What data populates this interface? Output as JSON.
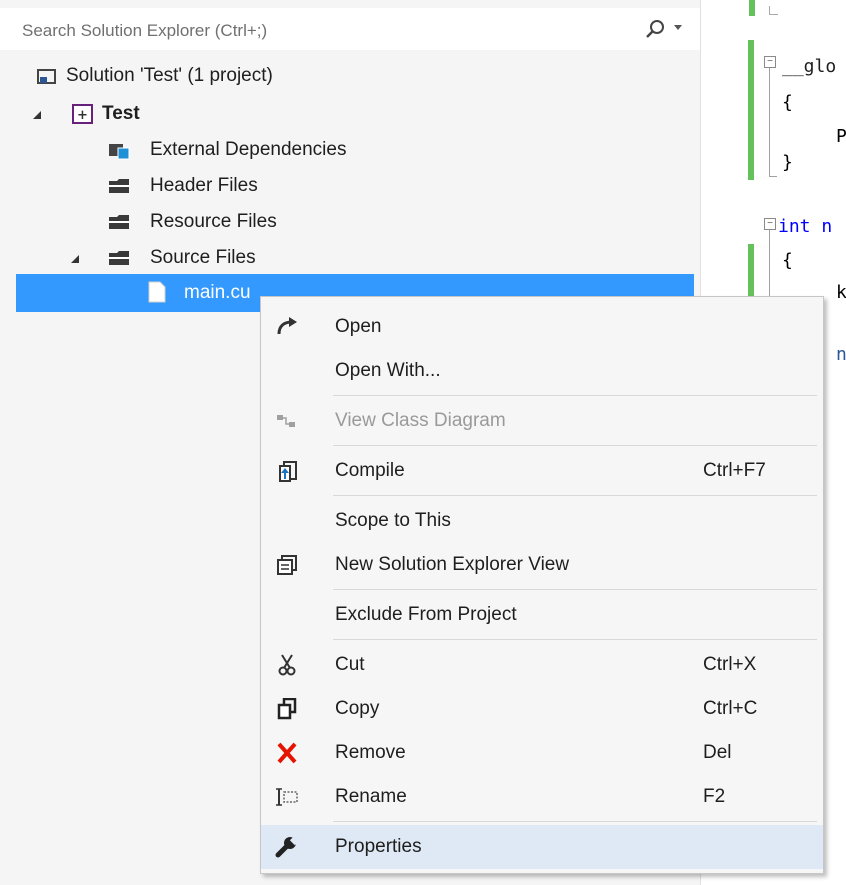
{
  "search": {
    "placeholder": "Search Solution Explorer (Ctrl+;)"
  },
  "tree": {
    "solution": "Solution 'Test' (1 project)",
    "project": "Test",
    "folders": [
      "External Dependencies",
      "Header Files",
      "Resource Files",
      "Source Files"
    ],
    "selected_file": "main.cu"
  },
  "code": [
    "__glo",
    "{",
    "P",
    "}",
    "int n",
    "{",
    "k",
    "n"
  ],
  "menu": {
    "items": [
      {
        "label": "Open",
        "shortcut": "",
        "icon": "open-arrow-icon",
        "disabled": false
      },
      {
        "label": "Open With...",
        "shortcut": "",
        "icon": "",
        "disabled": false
      },
      {
        "label": "View Class Diagram",
        "shortcut": "",
        "icon": "class-diagram-icon",
        "disabled": true
      },
      {
        "label": "Compile",
        "shortcut": "Ctrl+F7",
        "icon": "compile-icon",
        "disabled": false
      },
      {
        "label": "Scope to This",
        "shortcut": "",
        "icon": "",
        "disabled": false
      },
      {
        "label": "New Solution Explorer View",
        "shortcut": "",
        "icon": "new-view-icon",
        "disabled": false
      },
      {
        "label": "Exclude From Project",
        "shortcut": "",
        "icon": "",
        "disabled": false
      },
      {
        "label": "Cut",
        "shortcut": "Ctrl+X",
        "icon": "scissors-icon",
        "disabled": false
      },
      {
        "label": "Copy",
        "shortcut": "Ctrl+C",
        "icon": "copy-icon",
        "disabled": false
      },
      {
        "label": "Remove",
        "shortcut": "Del",
        "icon": "remove-x-icon",
        "disabled": false
      },
      {
        "label": "Rename",
        "shortcut": "F2",
        "icon": "rename-icon",
        "disabled": false
      },
      {
        "label": "Properties",
        "shortcut": "",
        "icon": "wrench-icon",
        "disabled": false
      }
    ]
  },
  "colors": {
    "selection": "#3399ff",
    "accent_green": "#65c15c",
    "keyword": "#0000ff",
    "remove_red": "#e51400"
  }
}
